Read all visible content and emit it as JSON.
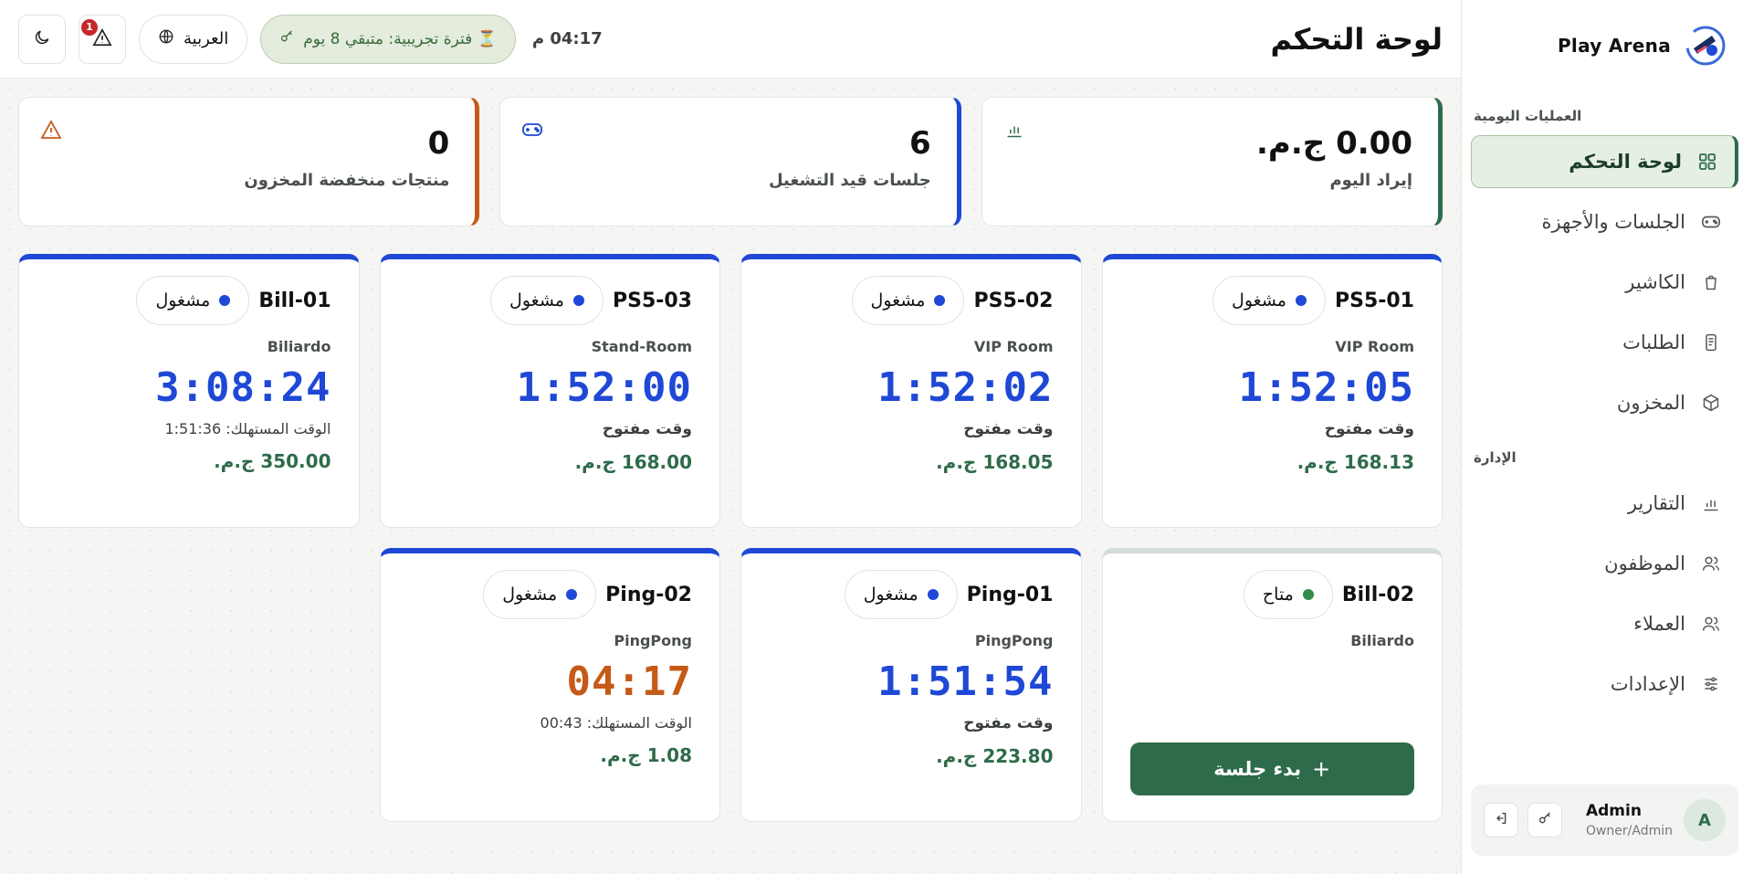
{
  "brand": {
    "name": "Play Arena"
  },
  "sidebar": {
    "section_daily": "العمليات اليومية",
    "section_admin": "الإدارة",
    "items": [
      {
        "label": "لوحة التحكم",
        "icon": "grid-icon",
        "active": true
      },
      {
        "label": "الجلسات والأجهزة",
        "icon": "gamepad-icon"
      },
      {
        "label": "الكاشير",
        "icon": "shopping-bag-icon"
      },
      {
        "label": "الطلبات",
        "icon": "receipt-icon"
      },
      {
        "label": "المخزون",
        "icon": "box-icon"
      },
      {
        "label": "التقارير",
        "icon": "bar-chart-icon"
      },
      {
        "label": "الموظفون",
        "icon": "users-icon"
      },
      {
        "label": "العملاء",
        "icon": "customers-icon"
      },
      {
        "label": "الإعدادات",
        "icon": "sliders-icon"
      }
    ]
  },
  "user": {
    "avatar_letter": "A",
    "name": "Admin",
    "role": "Owner/Admin"
  },
  "header": {
    "title": "لوحة التحكم",
    "clock": "04:17 م",
    "trial": "⏳ فترة تجريبية: متبقي 8 يوم",
    "language": "العربية",
    "notifications_count": "1"
  },
  "stats": [
    {
      "value": "0.00 ج.م.",
      "label": "إيراد اليوم",
      "icon": "bar-chart-icon",
      "color": "#2e6b4a"
    },
    {
      "value": "6",
      "label": "جلسات قيد التشغيل",
      "icon": "gamepad-icon",
      "color": "#1f48d6"
    },
    {
      "value": "0",
      "label": "منتجات منخفضة المخزون",
      "icon": "warning-icon",
      "color": "#c55a16"
    }
  ],
  "devices": [
    {
      "name": "PS5-01",
      "status": "مشغول",
      "type": "VIP Room",
      "timer": "1:52:05",
      "mode": "وقت مفتوح",
      "amount": "168.13 ج.م."
    },
    {
      "name": "PS5-02",
      "status": "مشغول",
      "type": "VIP Room",
      "timer": "1:52:02",
      "mode": "وقت مفتوح",
      "amount": "168.05 ج.م."
    },
    {
      "name": "PS5-03",
      "status": "مشغول",
      "type": "Stand-Room",
      "timer": "1:52:00",
      "mode": "وقت مفتوح",
      "amount": "168.00 ج.م."
    },
    {
      "name": "Bill-01",
      "status": "مشغول",
      "type": "Biliardo",
      "timer": "3:08:24",
      "consumed": "الوقت المستهلك: 1:51:36",
      "amount": "350.00 ج.م."
    },
    {
      "name": "Bill-02",
      "status": "متاح",
      "type": "Biliardo",
      "start_label": "بدء جلسة"
    },
    {
      "name": "Ping-01",
      "status": "مشغول",
      "type": "PingPong",
      "timer": "1:51:54",
      "mode": "وقت مفتوح",
      "amount": "223.80 ج.م."
    },
    {
      "name": "Ping-02",
      "status": "مشغول",
      "type": "PingPong",
      "timer": "04:17",
      "consumed": "الوقت المستهلك: 00:43",
      "amount": "1.08 ج.م."
    }
  ]
}
